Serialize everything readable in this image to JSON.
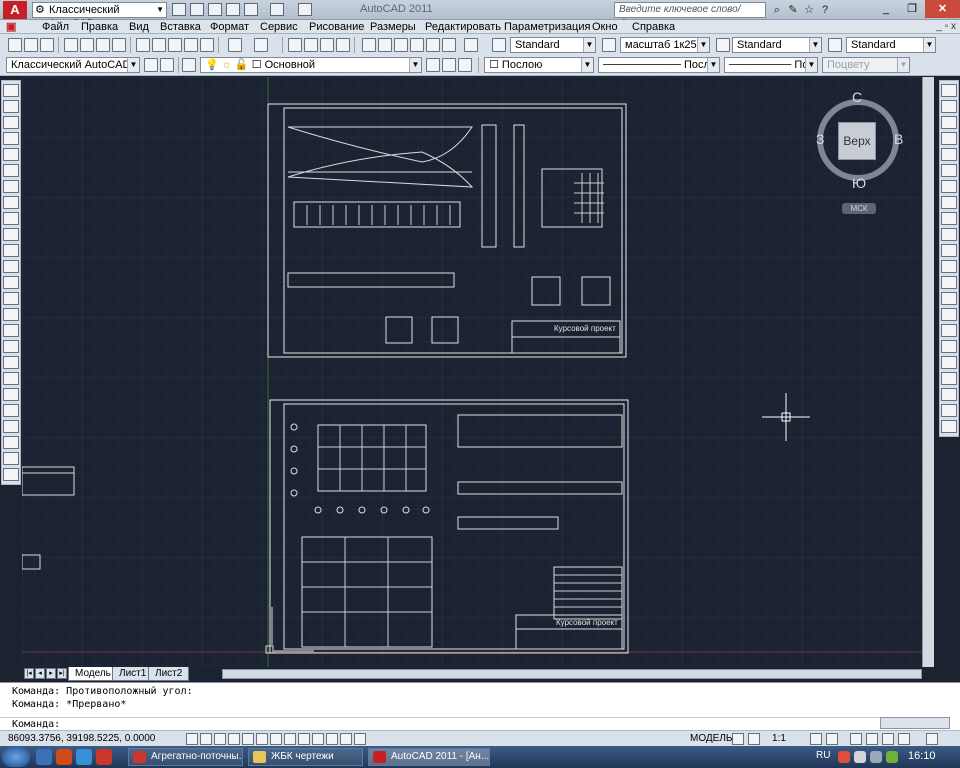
{
  "titlebar": {
    "logo": "A",
    "workspace": "Классический AutoCAD",
    "title": "AutoCAD 2011",
    "search_placeholder": "Введите ключевое слово/фразу"
  },
  "menu": {
    "items": [
      "Файл",
      "Правка",
      "Вид",
      "Вставка",
      "Формат",
      "Сервис",
      "Рисование",
      "Размеры",
      "Редактировать",
      "Параметризация",
      "Окно",
      "Справка"
    ],
    "doc_controls": "_ ▫ x"
  },
  "styles": {
    "text_style": "Standard",
    "dim_style": "масштаб 1к25",
    "table_style": "Standard",
    "mleader_style": "Standard"
  },
  "layers": {
    "workspace": "Классический AutoCAD",
    "current_layer": "Основной",
    "color": "Послою",
    "linetype": "Послою",
    "lineweight": "Послою",
    "plotstyle": "Поцвету"
  },
  "viewcube": {
    "north": "С",
    "south": "Ю",
    "west": "З",
    "east": "В",
    "top": "Верх",
    "ucs": "МСК"
  },
  "layout_tabs": [
    "Модель",
    "Лист1",
    "Лист2"
  ],
  "command": {
    "line1": "Команда: Противоположный угол:",
    "line2": "Команда: *Прервано*",
    "prompt": "Команда:"
  },
  "status": {
    "coords": "86093.3756, 39198.5225, 0.0000",
    "model": "МОДЕЛЬ",
    "scale": "1:1"
  },
  "taskbar": {
    "items": [
      {
        "label": "Агрегатно-поточны..."
      },
      {
        "label": "ЖБК чертежи"
      },
      {
        "label": "AutoCAD 2011 - [Ан..."
      }
    ],
    "lang": "RU",
    "clock": "16:10"
  },
  "drawing": {
    "sheet1_title": "Курсовой проект",
    "sheet2_title": "Курсовой проект"
  }
}
